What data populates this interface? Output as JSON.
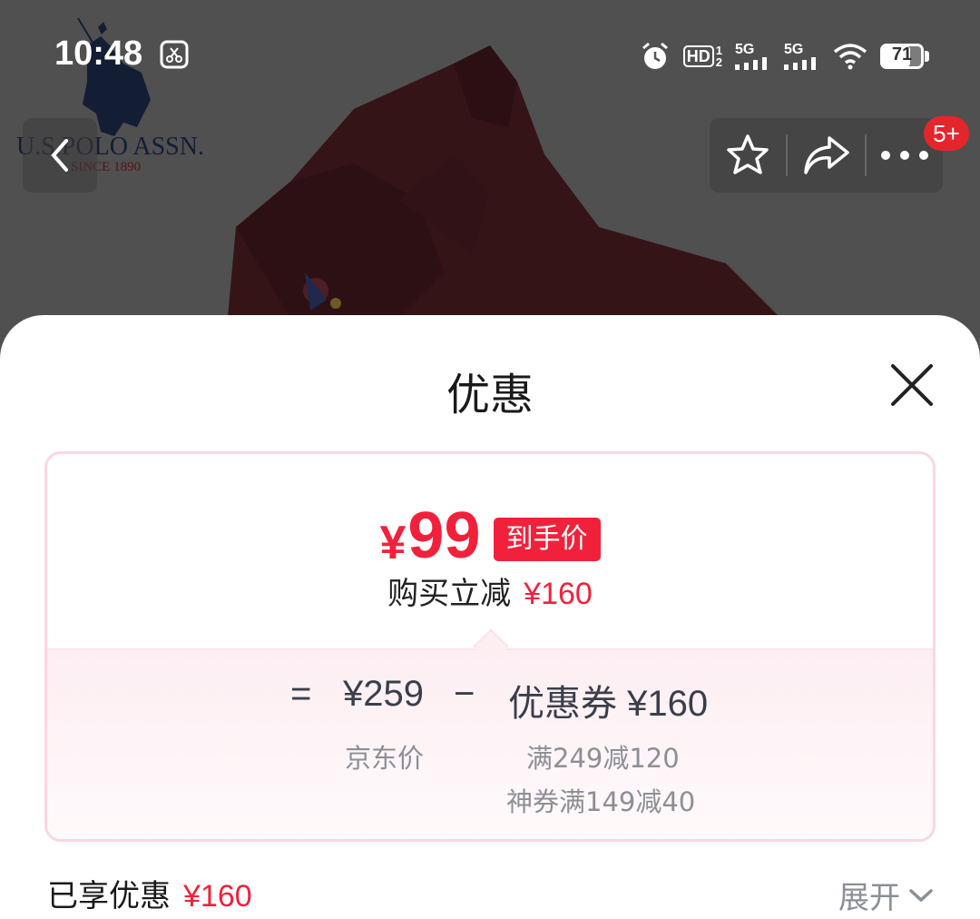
{
  "status_bar": {
    "time": "10:48",
    "hd_label": "HD",
    "hd_sup": "1",
    "hd_sub": "2",
    "net1": "5G",
    "net2": "5G",
    "battery": "71",
    "battery_level": 0.71
  },
  "brand": {
    "logo_text": "U.S.POLO ASSN.",
    "logo_since": "SINCE 1890"
  },
  "nav": {
    "badge": "5+"
  },
  "sheet": {
    "title": "优惠",
    "card": {
      "price_symbol": "¥",
      "price_value": "99",
      "price_tag": "到手价",
      "reduce_label": "购买立减",
      "reduce_amount": "¥160",
      "equals": "=",
      "base_price": "¥259",
      "base_label": "京东价",
      "minus": "−",
      "coupon_label": "优惠券",
      "coupon_amount": "¥160",
      "coupon_rule_1": "满249减120",
      "coupon_rule_2": "神券满149减40"
    },
    "footer": {
      "label": "已享优惠",
      "amount": "¥160",
      "expand": "展开"
    }
  },
  "colors": {
    "accent_red": "#f2213b",
    "card_border": "#fbd6e1"
  }
}
